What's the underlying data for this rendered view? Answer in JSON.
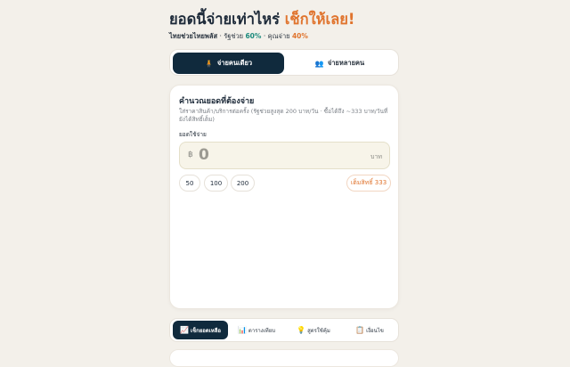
{
  "header": {
    "title_main": "ยอดนี้จ่ายเท่าไหร่",
    "title_accent": "เช็กให้เลย!",
    "brand": "ไทยช่วยไทยพลัส",
    "gov_label": "· รัฐช่วย",
    "gov_percent": "60%",
    "you_label": "· คุณจ่าย",
    "you_percent": "40%"
  },
  "mode_toggle": {
    "single_icon": "🧍",
    "single_label": "จ่ายคนเดียว",
    "group_icon": "👥",
    "group_label": "จ่ายหลายคน",
    "selected": "single"
  },
  "calculator": {
    "title": "คำนวณยอดที่ต้องจ่าย",
    "description": "ใส่ราคาสินค้า/บริการต่อครั้ง (รัฐช่วยสูงสุด 200 บาท/วัน · ซื้อได้ถึง ~333 บาท/วันที่ยังได้สิทธิ์เต็ม)",
    "amount_label": "ยอดใช้จ่าย",
    "currency_symbol": "฿",
    "amount_value": "0",
    "unit": "บาท",
    "quick_amounts": [
      "50",
      "100",
      "200"
    ],
    "full_right_label": "เต็มสิทธิ์ 333"
  },
  "bottom_nav": {
    "items": [
      {
        "icon": "📈",
        "label": "เช็กยอดเหลือ"
      },
      {
        "icon": "📊",
        "label": "ตารางเทียบ"
      },
      {
        "icon": "💡",
        "label": "สูตรใช้คุ้ม"
      },
      {
        "icon": "📋",
        "label": "เงื่อนไข"
      }
    ],
    "active_index": 0
  },
  "colors": {
    "background": "#f3f0ea",
    "navy": "#102a3d",
    "accent_orange": "#e0742e",
    "teal": "#1b8a7c",
    "input_bg": "#f7f4e9"
  }
}
